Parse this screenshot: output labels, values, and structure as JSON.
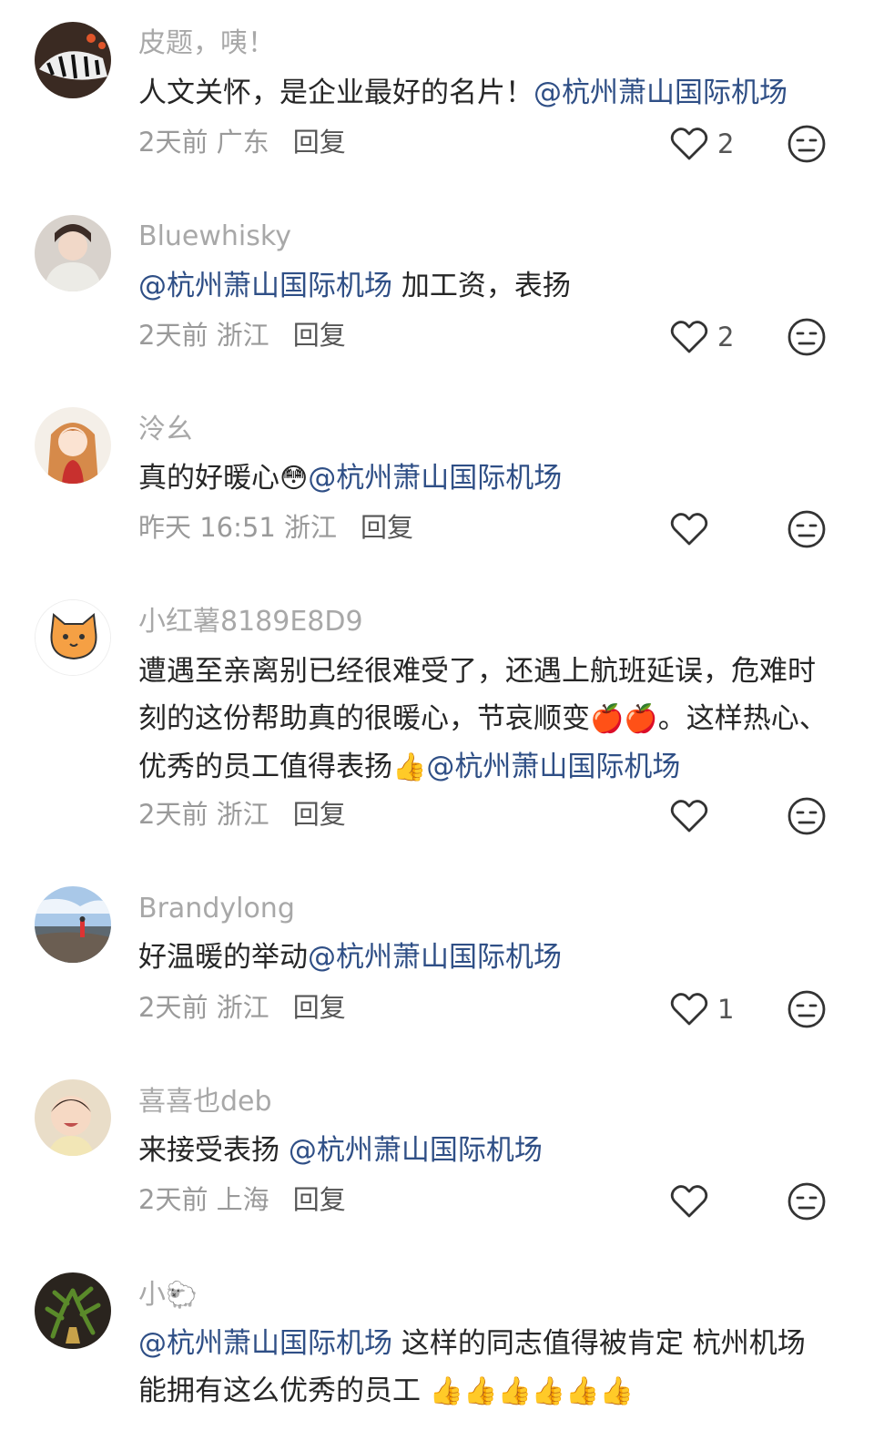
{
  "comments": [
    {
      "username": "皮题，咦！",
      "text_before": "人文关怀，是企业最好的名片！",
      "mention": "@杭州萧山国际机场",
      "text_after": "",
      "time": "2天前",
      "location": "广东",
      "reply": "回复",
      "likes": "2"
    },
    {
      "username": "Bluewhisky",
      "text_before": "",
      "mention": "@杭州萧山国际机场",
      "text_after": " 加工资，表扬",
      "time": "2天前",
      "location": "浙江",
      "reply": "回复",
      "likes": "2"
    },
    {
      "username": "泠幺",
      "text_before": "真的好暖心",
      "emoji_mid": "😳",
      "mention": "@杭州萧山国际机场",
      "text_after": "",
      "time": "昨天 16:51",
      "location": "浙江",
      "reply": "回复",
      "likes": ""
    },
    {
      "username": "小红薯8189E8D9",
      "text_before": "遭遇至亲离别已经很难受了，还遇上航班延误，危难时刻的这份帮助真的很暖心，节哀顺变",
      "emoji_a": "🍎🍎",
      "text_mid": "。这样热心、优秀的员工值得表扬",
      "emoji_b": "👍",
      "mention": "@杭州萧山国际机场",
      "time": "2天前",
      "location": "浙江",
      "reply": "回复",
      "likes": ""
    },
    {
      "username": "Brandylong",
      "text_before": "好温暖的举动",
      "mention": "@杭州萧山国际机场",
      "text_after": "",
      "time": "2天前",
      "location": "浙江",
      "reply": "回复",
      "likes": "1"
    },
    {
      "username": "喜喜也deb",
      "text_before": "来接受表扬 ",
      "mention": "@杭州萧山国际机场",
      "text_after": "",
      "time": "2天前",
      "location": "上海",
      "reply": "回复",
      "likes": ""
    },
    {
      "username": "小",
      "username_emoji": "🐑",
      "text_before": "",
      "mention": "@杭州萧山国际机场",
      "text_after": "  这样的同志值得被肯定 杭州机场能拥有这么优秀的员工 ",
      "emoji_tail": "👍👍👍👍👍👍"
    }
  ],
  "colors": {
    "mention": "#2f4f86",
    "username": "#a8a8a8",
    "meta": "#9a9a9a",
    "text": "#262626"
  },
  "icons": [
    "heart-icon",
    "dislike-face-icon"
  ]
}
